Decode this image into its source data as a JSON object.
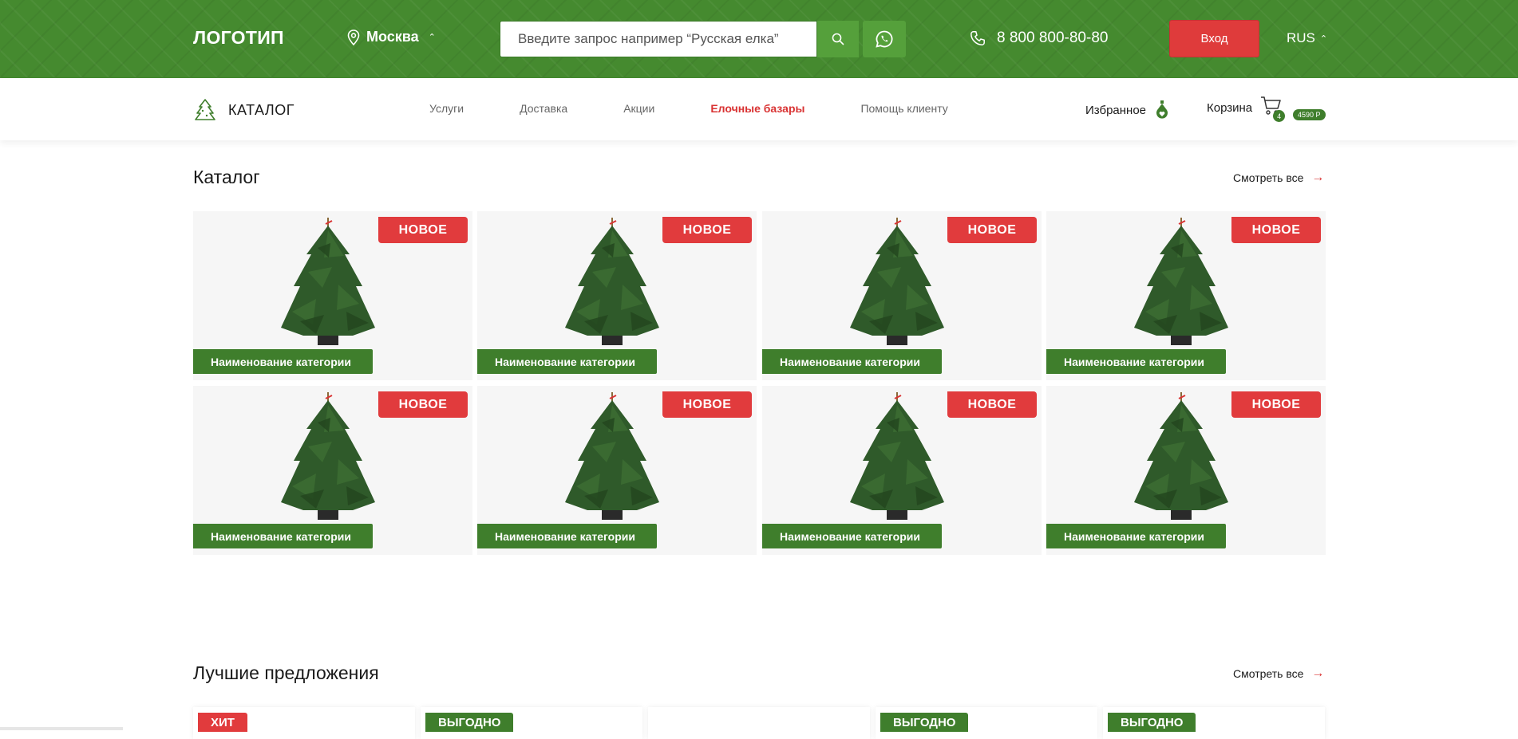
{
  "header": {
    "logo": "ЛОГОТИП",
    "city": "Москва",
    "search_placeholder": "Введите запрос например “Русская елка”",
    "phone": "8 800 800-80-80",
    "login_label": "Вход",
    "language": "RUS"
  },
  "nav": {
    "catalog_label": "КАТАЛОГ",
    "items": [
      "Услуги",
      "Доставка",
      "Акции",
      "Елочные базары",
      "Помощь клиенту"
    ],
    "favorites_label": "Избранное",
    "cart_label": "Корзина",
    "cart_count": "4",
    "cart_sum": "4590 Р"
  },
  "catalog": {
    "title": "Каталог",
    "see_all": "Смотреть все",
    "cards": [
      {
        "badge": "НОВОЕ",
        "label": "Наименование категории"
      },
      {
        "badge": "НОВОЕ",
        "label": "Наименование категории"
      },
      {
        "badge": "НОВОЕ",
        "label": "Наименование категории"
      },
      {
        "badge": "НОВОЕ",
        "label": "Наименование категории"
      },
      {
        "badge": "НОВОЕ",
        "label": "Наименование категории"
      },
      {
        "badge": "НОВОЕ",
        "label": "Наименование категории"
      },
      {
        "badge": "НОВОЕ",
        "label": "Наименование категории"
      },
      {
        "badge": "НОВОЕ",
        "label": "Наименование категории"
      }
    ]
  },
  "offers": {
    "title": "Лучшие предложения",
    "see_all": "Смотреть все",
    "tags": [
      "ХИТ",
      "ВЫГОДНО",
      "",
      "ВЫГОДНО",
      "ВЫГОДНО"
    ]
  },
  "colors": {
    "brand_green": "#458a2f",
    "dark_green": "#3f7e2c",
    "accent_red": "#e13b3d"
  },
  "icons": {
    "city": "location-pin-icon",
    "search": "search-icon",
    "whatsapp": "whatsapp-icon",
    "phone": "phone-icon",
    "catalog": "tree-icon",
    "favorites": "ornament-icon",
    "cart": "cart-icon",
    "see_all": "arrow-right-icon"
  }
}
